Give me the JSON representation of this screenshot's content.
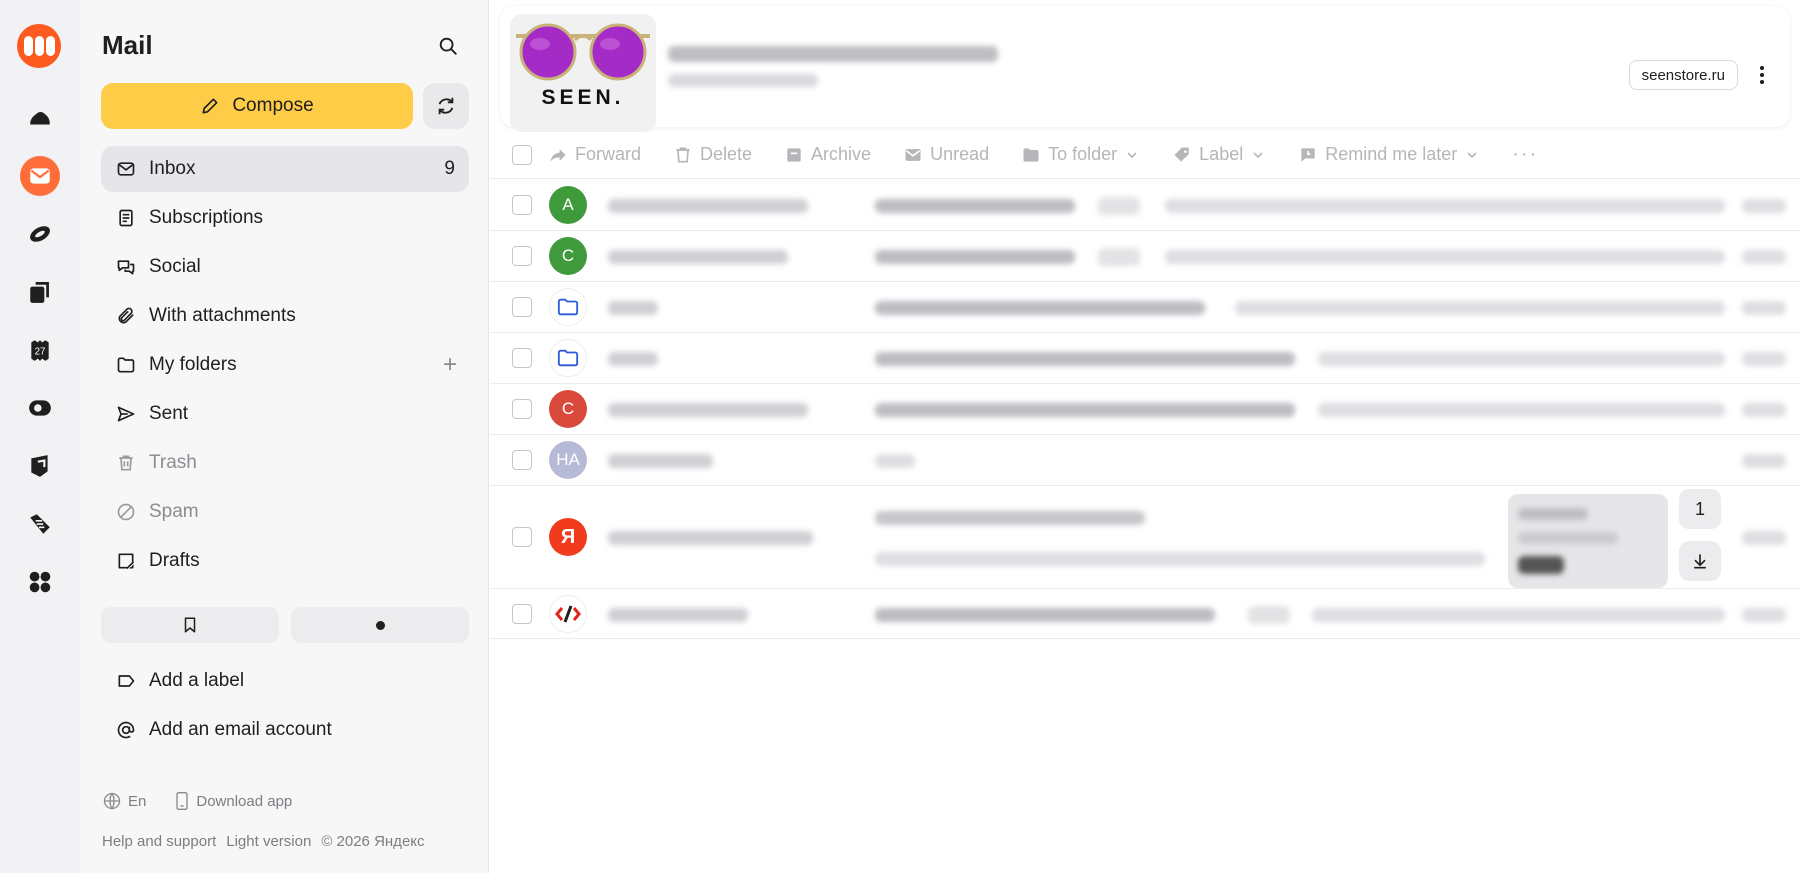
{
  "app": {
    "title": "Mail"
  },
  "sidebar": {
    "compose_label": "Compose",
    "items": [
      {
        "label": "Inbox",
        "count": "9",
        "icon": "inbox-icon"
      },
      {
        "label": "Subscriptions",
        "icon": "subscriptions-icon"
      },
      {
        "label": "Social",
        "icon": "social-icon"
      },
      {
        "label": "With attachments",
        "icon": "paperclip-icon"
      },
      {
        "label": "My folders",
        "icon": "folder-icon"
      },
      {
        "label": "Sent",
        "icon": "sent-icon"
      },
      {
        "label": "Trash",
        "icon": "trash-icon"
      },
      {
        "label": "Spam",
        "icon": "spam-icon"
      },
      {
        "label": "Drafts",
        "icon": "drafts-icon"
      }
    ],
    "add_label": "Add a label",
    "add_account": "Add an email account",
    "language": "En",
    "download_app": "Download app",
    "help": "Help and support",
    "light_version": "Light version",
    "copyright": "© 2026 Яндекс"
  },
  "rail": {
    "calendar_day": "27"
  },
  "banner": {
    "brand": "SEEN.",
    "domain": "seenstore.ru"
  },
  "toolbar": {
    "forward": "Forward",
    "delete": "Delete",
    "archive": "Archive",
    "unread": "Unread",
    "to_folder": "To folder",
    "label": "Label",
    "remind": "Remind me later",
    "more": "···"
  },
  "messages": [
    {
      "avatar_text": "А",
      "avatar_color": "#3e9a3a"
    },
    {
      "avatar_text": "С",
      "avatar_color": "#3e9a3a"
    },
    {
      "avatar_text": "",
      "avatar_color": "#ffffff"
    },
    {
      "avatar_text": "",
      "avatar_color": "#ffffff"
    },
    {
      "avatar_text": "С",
      "avatar_color": "#d94a3d"
    },
    {
      "avatar_text": "НА",
      "avatar_color": "#b6bad6"
    },
    {
      "avatar_text": "Я",
      "avatar_color": "#f03b1f"
    },
    {
      "avatar_text": "",
      "avatar_color": "#ffffff"
    }
  ],
  "attachment": {
    "count": "1"
  },
  "colors": {
    "accent": "#ffcc47",
    "brand": "#fc5a1f"
  }
}
